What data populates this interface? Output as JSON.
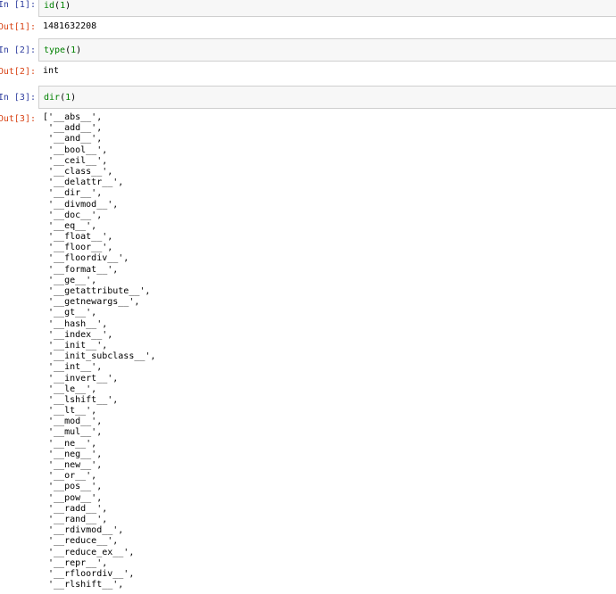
{
  "cells": [
    {
      "in_prompt": "In  [1]:",
      "code_fn": "id",
      "code_arg": "1",
      "out_prompt": "Out[1]:",
      "output": "1481632208"
    },
    {
      "in_prompt": "In  [2]:",
      "code_fn": "type",
      "code_arg": "1",
      "out_prompt": "Out[2]:",
      "output": "int"
    },
    {
      "in_prompt": "In  [3]:",
      "code_fn": "dir",
      "code_arg": "1",
      "out_prompt": "Out[3]:",
      "output_list": [
        "['__abs__',",
        " '__add__',",
        " '__and__',",
        " '__bool__',",
        " '__ceil__',",
        " '__class__',",
        " '__delattr__',",
        " '__dir__',",
        " '__divmod__',",
        " '__doc__',",
        " '__eq__',",
        " '__float__',",
        " '__floor__',",
        " '__floordiv__',",
        " '__format__',",
        " '__ge__',",
        " '__getattribute__',",
        " '__getnewargs__',",
        " '__gt__',",
        " '__hash__',",
        " '__index__',",
        " '__init__',",
        " '__init_subclass__',",
        " '__int__',",
        " '__invert__',",
        " '__le__',",
        " '__lshift__',",
        " '__lt__',",
        " '__mod__',",
        " '__mul__',",
        " '__ne__',",
        " '__neg__',",
        " '__new__',",
        " '__or__',",
        " '__pos__',",
        " '__pow__',",
        " '__radd__',",
        " '__rand__',",
        " '__rdivmod__',",
        " '__reduce__',",
        " '__reduce_ex__',",
        " '__repr__',",
        " '__rfloordiv__',",
        " '__rlshift__',"
      ]
    }
  ]
}
